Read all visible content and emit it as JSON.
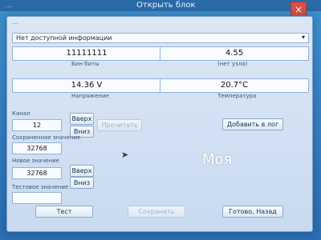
{
  "topbar": {
    "left_text": "...",
    "center_title": "Открыть блок",
    "close_label": "×"
  },
  "window": {
    "title": "...",
    "dropdown": {
      "value": "Нет доступной информации"
    },
    "readouts": {
      "bits_value": "11111111",
      "bits_label": "Бин биты",
      "node_value": "4.55",
      "node_label": "(нет узла)",
      "voltage_value": "14.36 V",
      "voltage_label": "Напряжение",
      "temp_value": "20.7°C",
      "temp_label": "Температура"
    },
    "left_panel": {
      "channel_label": "Канал",
      "channel_value": "12",
      "up_label": "Вверх",
      "down_label": "Вниз",
      "saved_label": "Сохраненное значение",
      "saved_value": "32768",
      "new_label": "Новое значение",
      "new_value": "32768",
      "test_label": "Тестовое значение",
      "test_value": ""
    },
    "buttons": {
      "read": "Прочитать",
      "add_log": "Добавить в лог",
      "test": "Тест",
      "save": "Сохранить",
      "done_back": "Готово, Назад"
    }
  },
  "overlay_text": "Моя"
}
